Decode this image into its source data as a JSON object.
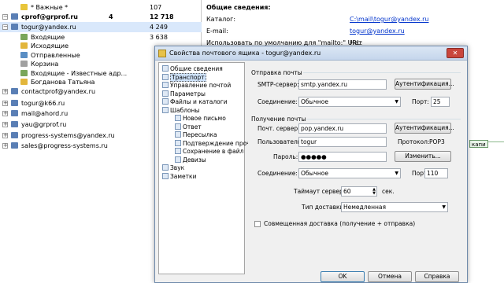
{
  "sidebar": {
    "rows": [
      {
        "label": "* Важные *",
        "c1": "",
        "c2": "107",
        "bold": false,
        "indent": 1,
        "color": "#e8c53a"
      },
      {
        "label": "cprof@grprof.ru",
        "c1": "4",
        "c2": "12 718",
        "bold": true,
        "indent": 0,
        "color": "#5a7fb5"
      },
      {
        "label": "togur@yandex.ru",
        "c1": "",
        "c2": "4 249",
        "bold": false,
        "indent": 0,
        "color": "#5a7fb5"
      },
      {
        "label": "Входящие",
        "c1": "",
        "c2": "3 638",
        "bold": false,
        "indent": 1,
        "color": "#7aa65a"
      },
      {
        "label": "Исходящие",
        "c1": "",
        "c2": "",
        "bold": false,
        "indent": 1,
        "color": "#e2b63c"
      },
      {
        "label": "Отправленные",
        "c1": "",
        "c2": "",
        "bold": false,
        "indent": 1,
        "color": "#5a8ec4"
      },
      {
        "label": "Корзина",
        "c1": "",
        "c2": "",
        "bold": false,
        "indent": 1,
        "color": "#a0a0a0"
      },
      {
        "label": "Входящие - Известные адр...",
        "c1": "",
        "c2": "",
        "bold": false,
        "indent": 1,
        "color": "#7aa65a"
      },
      {
        "label": "Богданова Татьяна",
        "c1": "",
        "c2": "",
        "bold": false,
        "indent": 1,
        "color": "#e2b63c"
      },
      {
        "label": "contactprof@yandex.ru",
        "c1": "",
        "c2": "",
        "bold": false,
        "indent": 0,
        "color": "#5a7fb5"
      },
      {
        "label": "togur@k66.ru",
        "c1": "",
        "c2": "",
        "bold": false,
        "indent": 0,
        "color": "#5a7fb5"
      },
      {
        "label": "mail@ahord.ru",
        "c1": "",
        "c2": "",
        "bold": false,
        "indent": 0,
        "color": "#5a7fb5"
      },
      {
        "label": "yau@grprof.ru",
        "c1": "",
        "c2": "",
        "bold": false,
        "indent": 0,
        "color": "#5a7fb5"
      },
      {
        "label": "progress-systems@yandex.ru",
        "c1": "",
        "c2": "",
        "bold": false,
        "indent": 0,
        "color": "#5a7fb5"
      },
      {
        "label": "sales@progress-systems.ru",
        "c1": "",
        "c2": "",
        "bold": false,
        "indent": 0,
        "color": "#5a7fb5"
      }
    ]
  },
  "info": {
    "title": "Общие сведения:",
    "rows": [
      {
        "label": "Каталог:",
        "value": "C:\\mail\\togur@yandex.ru",
        "link": true
      },
      {
        "label": "E-mail:",
        "value": "togur@yandex.ru",
        "link": true
      },
      {
        "label": "Использовать по умолчанию для \"mailto:\" URL:",
        "value": "Нет",
        "link": false
      }
    ],
    "side_tag": "капи"
  },
  "dialog": {
    "title": "Свойства почтового ящика - togur@yandex.ru",
    "close": "✕",
    "tree": [
      {
        "label": "Общие сведения",
        "level": 1,
        "active": false
      },
      {
        "label": "Транспорт",
        "level": 1,
        "active": true
      },
      {
        "label": "Управление почтой",
        "level": 1,
        "active": false
      },
      {
        "label": "Параметры",
        "level": 1,
        "active": false
      },
      {
        "label": "Файлы и каталоги",
        "level": 1,
        "active": false
      },
      {
        "label": "Шаблоны",
        "level": 1,
        "active": false
      },
      {
        "label": "Новое письмо",
        "level": 2,
        "active": false
      },
      {
        "label": "Ответ",
        "level": 2,
        "active": false
      },
      {
        "label": "Пересылка",
        "level": 2,
        "active": false
      },
      {
        "label": "Подтверждение прочт",
        "level": 2,
        "active": false
      },
      {
        "label": "Сохранение в файл",
        "level": 2,
        "active": false
      },
      {
        "label": "Девизы",
        "level": 2,
        "active": false
      },
      {
        "label": "Звук",
        "level": 1,
        "active": false
      },
      {
        "label": "Заметки",
        "level": 1,
        "active": false
      }
    ],
    "send": {
      "group": "Отправка почты",
      "smtp_label": "SMTP-сервер:",
      "smtp_value": "smtp.yandex.ru",
      "auth_button": "Аутентификация...",
      "conn_label": "Соединение:",
      "conn_value": "Обычное",
      "port_label": "Порт:",
      "port_value": "25"
    },
    "recv": {
      "group": "Получение почты",
      "server_label": "Почт. сервер:",
      "server_value": "pop.yandex.ru",
      "auth_button": "Аутентификация...",
      "user_label": "Пользователь:",
      "user_value": "togur",
      "protocol_label": "Протокол:",
      "protocol_value": "POP3",
      "pass_label": "Пароль:",
      "pass_value": "●●●●●",
      "change_button": "Изменить...",
      "conn_label": "Соединение:",
      "conn_value": "Обычное",
      "port_label": "Порт:",
      "port_value": "110"
    },
    "timeout_label": "Таймаут сервера:",
    "timeout_value": "60",
    "timeout_unit": "сек.",
    "delivery_label": "Тип доставки:",
    "delivery_value": "Немедленная",
    "combined_label": "Совмещенная доставка (получение + отправка)",
    "ok": "OK",
    "cancel": "Отмена",
    "help": "Справка"
  }
}
